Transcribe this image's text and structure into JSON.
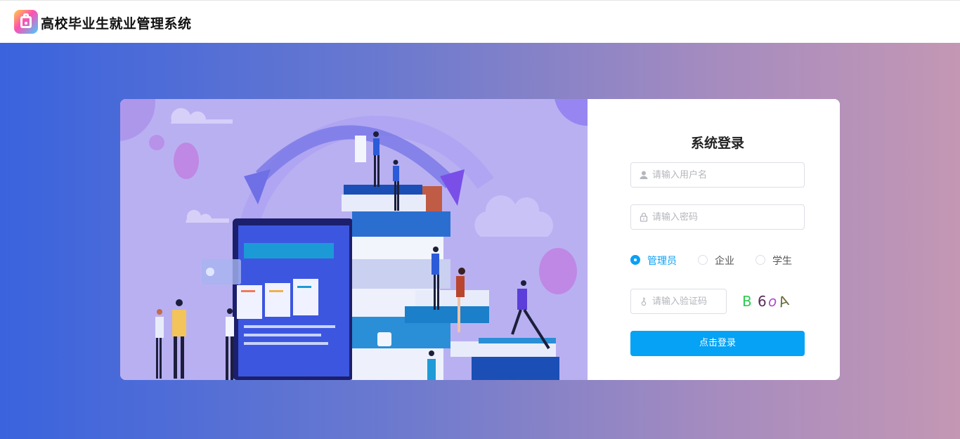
{
  "header": {
    "app_title": "高校毕业生就业管理系统",
    "logo_icon": "briefcase-icon"
  },
  "login": {
    "title": "系统登录",
    "username": {
      "placeholder": "请输入用户名",
      "value": "",
      "icon": "user-icon"
    },
    "password": {
      "placeholder": "请输入密码",
      "value": "",
      "icon": "lock-icon"
    },
    "roles": [
      {
        "label": "管理员",
        "checked": true
      },
      {
        "label": "企业",
        "checked": false
      },
      {
        "label": "学生",
        "checked": false
      }
    ],
    "captcha_input": {
      "placeholder": "请输入验证码",
      "value": "",
      "icon": "key-icon"
    },
    "captcha_chars": [
      "B",
      "6",
      "o",
      "A"
    ],
    "submit_label": "点击登录"
  },
  "colors": {
    "accent": "#05a2f5",
    "bg_left": "#3a63dd",
    "bg_right": "#c497b4",
    "illustration_bg": "#b9b0f2"
  }
}
